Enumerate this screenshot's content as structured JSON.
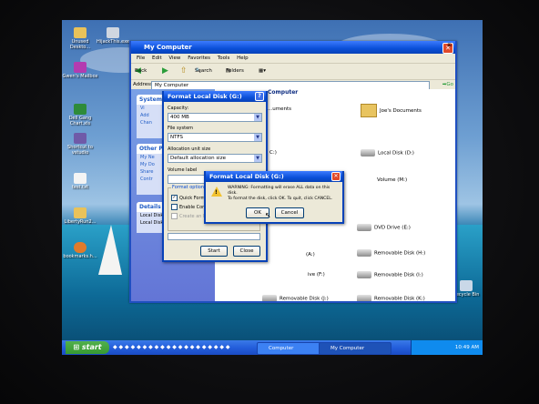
{
  "desktop_icons": [
    {
      "label": "Unused Deskto...",
      "icon": "folder-icon"
    },
    {
      "label": "HijackThis.exe",
      "icon": "hijackthis-icon"
    },
    {
      "label": "Gwen's Mailbox",
      "icon": "mailbox-icon"
    },
    {
      "label": "Dell Gang Chart.xls",
      "icon": "excel-file-icon"
    },
    {
      "label": "Shortcut to vstudio",
      "icon": "shortcut-icon"
    },
    {
      "label": "test.txt",
      "icon": "text-file-icon"
    },
    {
      "label": "LibertyRun2...",
      "icon": "folder-icon"
    },
    {
      "label": "bookmarks.h...",
      "icon": "firefox-icon"
    },
    {
      "label": "Recycle Bin",
      "icon": "recycle-bin-icon"
    }
  ],
  "my_computer": {
    "title": "My Computer",
    "menu": [
      "File",
      "Edit",
      "View",
      "Favorites",
      "Tools",
      "Help"
    ],
    "toolbar": {
      "back": "Back",
      "search": "Search",
      "folders": "Folders"
    },
    "address_label": "Address",
    "address_value": "My Computer",
    "go_label": "Go",
    "task_panels": [
      {
        "title": "System",
        "rows": [
          "Vi",
          "Add",
          "Chan"
        ]
      },
      {
        "title": "Other Pla",
        "rows": [
          "My Ne",
          "My Do",
          "Share",
          "Contr"
        ]
      },
      {
        "title": "Details",
        "rows": [
          "Local Disk",
          "Local Disk"
        ]
      }
    ],
    "group_header": "Computer",
    "items": [
      {
        "label": "...uments",
        "type": "folder"
      },
      {
        "label": "Joe's Documents",
        "type": "folder"
      },
      {
        "label": "C:)",
        "type": "disk"
      },
      {
        "label": "Local Disk (D:)",
        "type": "disk"
      },
      {
        "label": "Volume (M:)",
        "type": "disk"
      },
      {
        "label": "DVD Drive (E:)",
        "type": "disk"
      },
      {
        "label": "(A:)",
        "type": "disk"
      },
      {
        "label": "Removable Disk (H:)",
        "type": "disk"
      },
      {
        "label": "ive (F:)",
        "type": "disk"
      },
      {
        "label": "Removable Disk (I:)",
        "type": "disk"
      },
      {
        "label": "Removable Disk (J:)",
        "type": "disk"
      },
      {
        "label": "Removable Disk (K:)",
        "type": "disk"
      }
    ]
  },
  "format_dialog": {
    "title": "Format Local Disk (G:)",
    "capacity_label": "Capacity:",
    "capacity_value": "400 MB",
    "fs_label": "File system",
    "fs_value": "NTFS",
    "alloc_label": "Allocation unit size",
    "alloc_value": "Default allocation size",
    "volume_label": "Volume label",
    "volume_value": "",
    "options_label": "Format options",
    "opt_quick": "Quick Format",
    "opt_compress": "Enable Comp",
    "opt_msdos": "Create an M",
    "start": "Start",
    "close": "Close"
  },
  "warning_dialog": {
    "title": "Format Local Disk (G:)",
    "line1": "WARNING: Formatting will erase ALL data on this disk.",
    "line2": "To format the disk, click OK. To quit, click CANCEL.",
    "ok": "OK",
    "cancel": "Cancel"
  },
  "taskbar": {
    "start": "start",
    "tasks": [
      "Computer Management",
      "My Computer"
    ],
    "clock": "10:49 AM"
  },
  "colors": {
    "xp_blue": "#0a4fd8",
    "start_green": "#379a32",
    "dialog_face": "#ece9d8"
  }
}
